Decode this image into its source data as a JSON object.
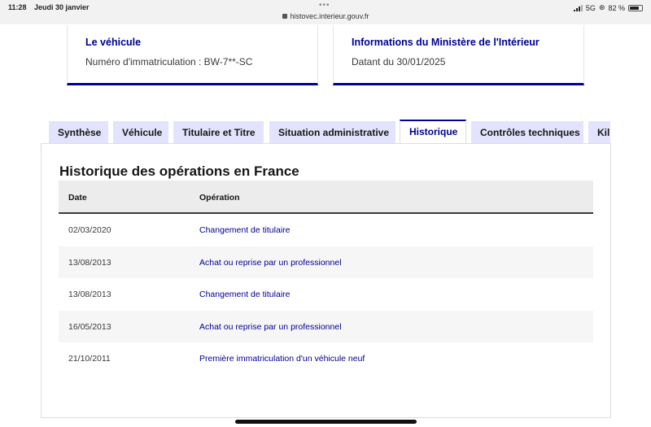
{
  "status_bar": {
    "time": "11:28",
    "date": "Jeudi 30 janvier",
    "url": "histovec.interieur.gouv.fr",
    "network": "5G",
    "battery": "82 %",
    "battery_level": 0.82
  },
  "cards": [
    {
      "title": "Le véhicule",
      "text": "Numéro d'immatriculation : BW-7**-SC"
    },
    {
      "title": "Informations du Ministère de l'Intérieur",
      "text": "Datant du 30/01/2025"
    }
  ],
  "tabs": [
    {
      "label": "Synthèse",
      "active": false
    },
    {
      "label": "Véhicule",
      "active": false
    },
    {
      "label": "Titulaire et Titre",
      "active": false
    },
    {
      "label": "Situation administrative",
      "active": false
    },
    {
      "label": "Historique",
      "active": true
    },
    {
      "label": "Contrôles techniques",
      "active": false
    },
    {
      "label": "Kil",
      "active": false
    }
  ],
  "history": {
    "title": "Historique des opérations en France",
    "columns": [
      "Date",
      "Opération"
    ],
    "rows": [
      {
        "date": "02/03/2020",
        "operation": "Changement de titulaire"
      },
      {
        "date": "13/08/2013",
        "operation": "Achat ou reprise par un professionnel"
      },
      {
        "date": "13/08/2013",
        "operation": "Changement de titulaire"
      },
      {
        "date": "16/05/2013",
        "operation": "Achat ou reprise par un professionnel"
      },
      {
        "date": "21/10/2011",
        "operation": "Première immatriculation d'un véhicule neuf"
      }
    ]
  },
  "colors": {
    "accent": "#000091",
    "tab_background": "#e3e3fd",
    "header_background": "#ececec",
    "row_stripe": "#f6f6f6"
  }
}
